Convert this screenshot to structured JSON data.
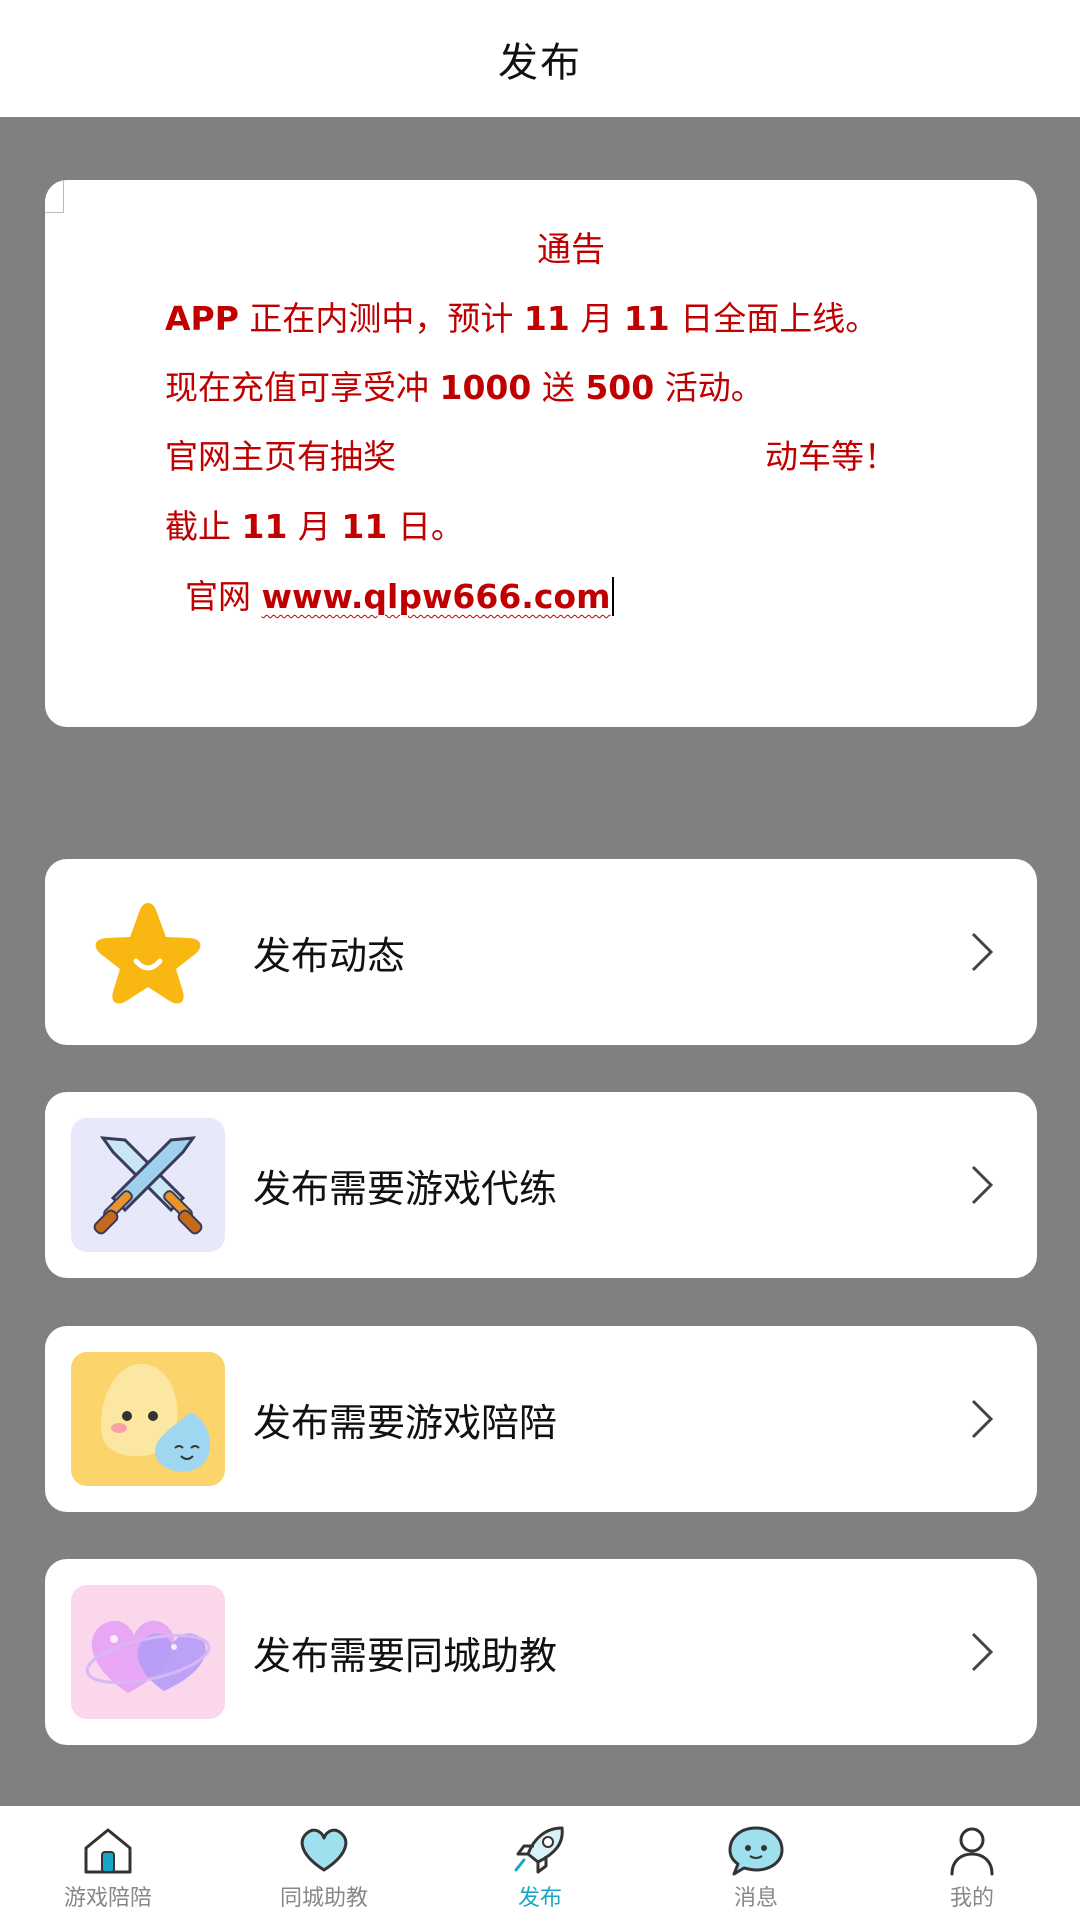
{
  "header": {
    "title": "发布"
  },
  "notice": {
    "title": "通告",
    "line1_a": "APP",
    "line1_b": " 正在内测中，预计 ",
    "line1_c": "11",
    "line1_d": " 月 ",
    "line1_e": "11",
    "line1_f": " 日全面上线。",
    "line2_a": "现在充值可享受冲 ",
    "line2_b": "1000",
    "line2_c": " 送 ",
    "line2_d": "500",
    "line2_e": " 活动。",
    "line3_a": "官网主页有抽奖",
    "line3_b": "动车等！",
    "line4_a": "截止 ",
    "line4_b": "11",
    "line4_c": " 月 ",
    "line4_d": "11",
    "line4_e": " 日。",
    "line5_a": "官网 ",
    "line5_url": "www.qlpw666.com"
  },
  "menu": [
    {
      "label": "发布动态",
      "icon": "star-smile-icon"
    },
    {
      "label": "发布需要游戏代练",
      "icon": "crossed-swords-icon"
    },
    {
      "label": "发布需要游戏陪陪",
      "icon": "cute-blobs-icon"
    },
    {
      "label": "发布需要同城助教",
      "icon": "hearts-icon"
    }
  ],
  "tabs": [
    {
      "label": "游戏陪陪",
      "icon": "home-icon"
    },
    {
      "label": "同城助教",
      "icon": "heart-icon"
    },
    {
      "label": "发布",
      "icon": "rocket-icon",
      "active": true
    },
    {
      "label": "消息",
      "icon": "chat-icon"
    },
    {
      "label": "我的",
      "icon": "user-icon"
    }
  ],
  "colors": {
    "notice_red": "#c00000",
    "active_tab": "#1aa5c8",
    "background": "#808080"
  }
}
